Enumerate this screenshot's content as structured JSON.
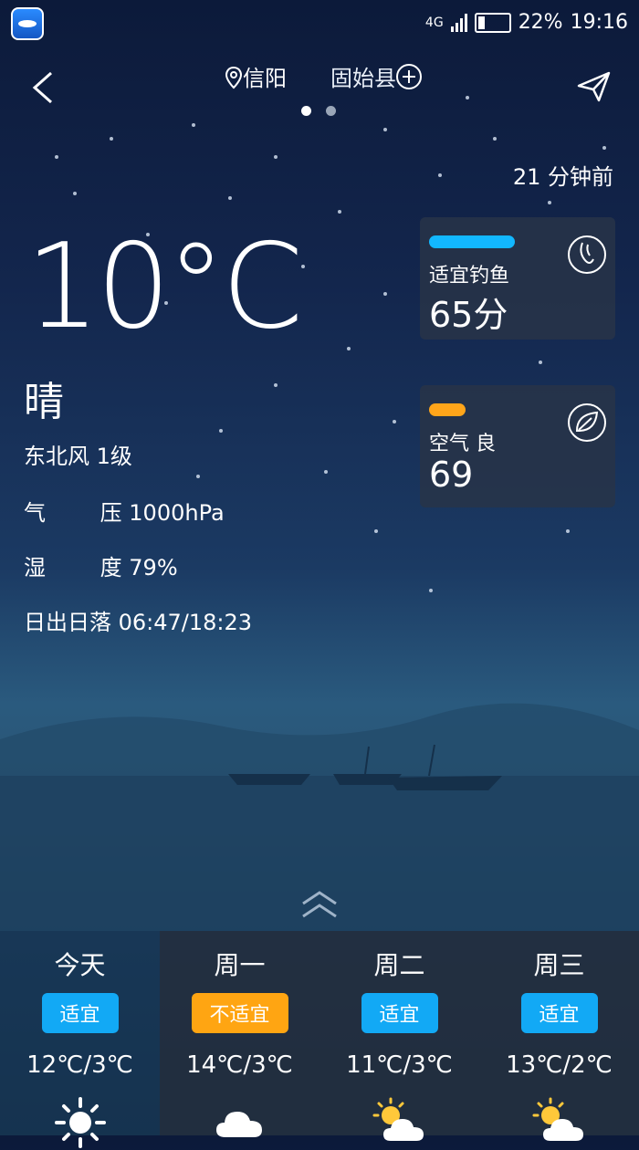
{
  "status_bar": {
    "network": "4G",
    "battery_level": 0.22,
    "battery": "22%",
    "time": "19:16"
  },
  "header": {
    "city_current": "信阳",
    "city_next": "固始县",
    "page_index": 0,
    "page_count": 2
  },
  "update_time": "21 分钟前",
  "current": {
    "temperature": "10°C",
    "condition": "晴",
    "wind": "东北风 1级",
    "pressure_label_a": "气",
    "pressure_label_b": "压",
    "pressure_value": "1000hPa",
    "humidity_label_a": "湿",
    "humidity_label_b": "度",
    "humidity_value": "79%",
    "sun_label": "日出日落",
    "sun_value": "06:47/18:23"
  },
  "fishing_card": {
    "label": "适宜钓鱼",
    "value": "65分",
    "bar_color": "#12b7ff"
  },
  "air_card": {
    "label": "空气 良",
    "value": "69",
    "bar_color": "#ffa51a"
  },
  "forecast": [
    {
      "day": "今天",
      "status": "适宜",
      "status_color": "#12a9f5",
      "temp": "12℃/3℃",
      "icon": "sun-icon"
    },
    {
      "day": "周一",
      "status": "不适宜",
      "status_color": "#ffa512",
      "temp": "14℃/3℃",
      "icon": "cloud-icon"
    },
    {
      "day": "周二",
      "status": "适宜",
      "status_color": "#12a9f5",
      "temp": "11℃/3℃",
      "icon": "partly-cloudy-icon"
    },
    {
      "day": "周三",
      "status": "适宜",
      "status_color": "#12a9f5",
      "temp": "13℃/2℃",
      "icon": "partly-cloudy-icon"
    }
  ]
}
